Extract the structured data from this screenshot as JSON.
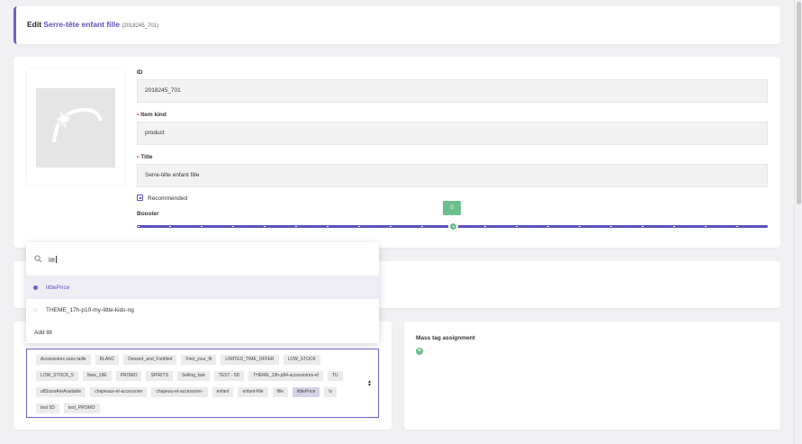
{
  "header": {
    "prefix": "Edit ",
    "product_name": "Serre-tête enfant fille",
    "sku": "(2018245_701)"
  },
  "form": {
    "id_label": "ID",
    "id_value": "2018245_701",
    "item_kind_label": "Item kind",
    "item_kind_value": "product",
    "title_label": "Title",
    "title_value": "Serre-tête enfant fille",
    "recommended_label": "Recommended",
    "booster_label": "Booster",
    "booster_value": "0"
  },
  "dropdown": {
    "search_value": "litt",
    "options": [
      {
        "label": "littlePrice",
        "active": true
      },
      {
        "label": "THEME_17h-p10-my-little-kids-ng",
        "active": false
      },
      {
        "label": "Add litt",
        "active": false
      }
    ]
  },
  "tags": [
    "Accessoires sans taille",
    "BLANC",
    "Dessert_and_Fortified",
    "Find_your_fit",
    "LIMITED_TIME_OFFER",
    "LOW_STOCK",
    "LOW_STOCK_5",
    "New_19E",
    "PROMO",
    "SPIRITS",
    "Selling_fast",
    "TEST - 5D",
    "THEME_19h-p84-accessoires-ef",
    "TU",
    "allSizesAreAvailable",
    "chapeaux-et-accessoire",
    "chapeau-et-accessoire-",
    "enfant",
    "enfant-fille",
    "fille",
    "littlePrice",
    "ls",
    "test 5D",
    "test_PROMO"
  ],
  "selected_tag": "littlePrice",
  "mass_tag": {
    "title": "Mass tag assignment"
  },
  "colors": {
    "accent": "#5a53b8",
    "green": "#6bbf8c",
    "required": "#e24a3a"
  },
  "icons": {
    "search": "search-icon",
    "add": "plus-circle-icon",
    "checkbox": "checkbox-icon"
  }
}
